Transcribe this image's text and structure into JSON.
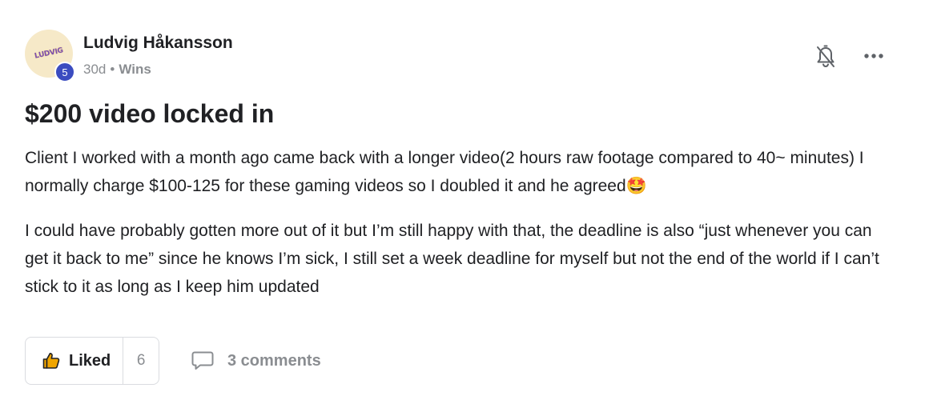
{
  "author": {
    "name": "Ludvig Håkansson",
    "avatar_text": "LUDVIG",
    "level": "5"
  },
  "meta": {
    "time": "30d",
    "separator": "•",
    "category": "Wins"
  },
  "post": {
    "title": "$200 video locked in",
    "paragraphs": [
      "Client I worked with a month ago came back with a longer video(2 hours raw footage compared to 40~ minutes) I normally charge $100-125 for these gaming videos so I doubled it and he agreed🤩",
      "I could have probably gotten more out of it but I’m still happy with that, the deadline is also “just whenever you can get it back to me” since he knows I’m sick, I still set a week deadline for myself but not the end of the world if I can’t stick to it as long as I keep him updated"
    ]
  },
  "actions": {
    "like_label": "Liked",
    "like_count": "6",
    "comments_label": "3 comments"
  },
  "icons": {
    "bell": "bell-off-icon",
    "more": "more-horizontal-icon",
    "like": "thumbs-up-icon",
    "comment": "comment-icon"
  },
  "colors": {
    "level_badge": "#3b4cc0",
    "avatar_bg": "#f6e9c8",
    "muted_text": "#8a8d91",
    "like_icon": "#f0a500"
  }
}
